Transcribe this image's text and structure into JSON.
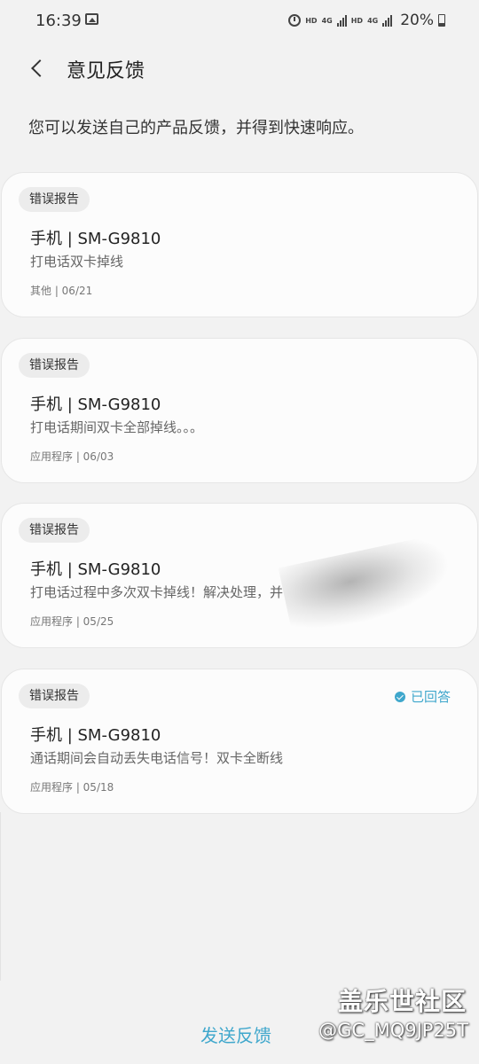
{
  "status_bar": {
    "time": "16:39",
    "battery": "20%",
    "labels": [
      "HD",
      "4G",
      "HD",
      "4G"
    ],
    "icons": [
      "gallery-icon",
      "alarm-icon",
      "signal-icon",
      "battery-icon"
    ]
  },
  "header": {
    "title": "意见反馈",
    "back_icon": "back-arrow-icon"
  },
  "intro_text": "您可以发送自己的产品反馈，并得到快速响应。",
  "cards": [
    {
      "badge": "错误报告",
      "title": "手机 | SM-G9810",
      "description": "打电话双卡掉线",
      "meta": "其他 | 06/21"
    },
    {
      "badge": "错误报告",
      "title": "手机 | SM-G9810",
      "description": "打电话期间双卡全部掉线。。。",
      "meta": "应用程序 | 06/03"
    },
    {
      "badge": "错误报告",
      "title": "手机 | SM-G9810",
      "description": "打电话过程中多次双卡掉线！解决处理，并",
      "meta": "应用程序 | 05/25"
    },
    {
      "badge": "错误报告",
      "title": "手机 | SM-G9810",
      "description": "通话期间会自动丢失电话信号！双卡全断线",
      "meta": "应用程序 | 05/18",
      "status": "已回答"
    }
  ],
  "footer": {
    "send_button": "发送反馈",
    "watermark_logo": "盖乐世社区",
    "watermark_handle": "@GC_MQ9JP25T"
  },
  "colors": {
    "background": "#f2f2f2",
    "card": "#fcfcfc",
    "accent": "#3fa7cc"
  }
}
